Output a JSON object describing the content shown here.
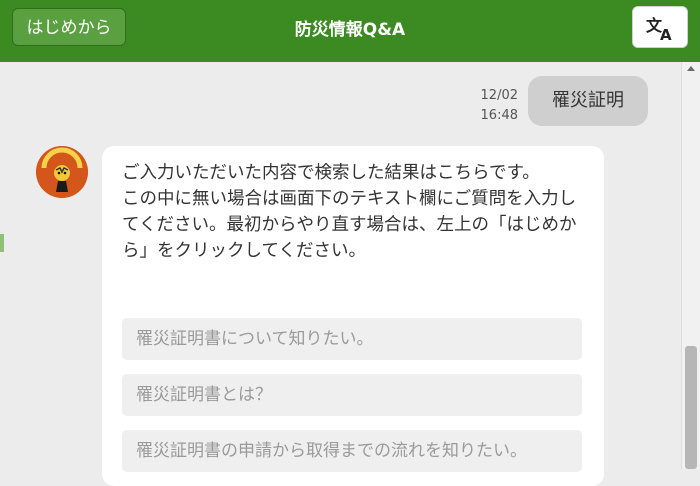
{
  "header": {
    "restart_label": "はじめから",
    "title": "防災情報Q&A",
    "translate_icon": "translate-icon"
  },
  "user_message": {
    "date": "12/02",
    "time": "16:48",
    "text": "罹災証明"
  },
  "bot_message": {
    "avatar_icon": "mascot-avatar",
    "text": "ご入力いただいた内容で検索した結果はこちらです。\nこの中に無い場合は画面下のテキスト欄にご質問を入力してください。最初からやり直す場合は、左上の「はじめから」をクリックしてください。",
    "suggestions": [
      "罹災証明書について知りたい。",
      "罹災証明書とは？",
      "罹災証明書の申請から取得までの流れを知りたい。"
    ]
  },
  "colors": {
    "header_green": "#3b8a22",
    "restart_green": "#5aa040",
    "chat_background": "#ececec",
    "user_bubble": "#cfcfcf",
    "bot_bubble": "#ffffff",
    "suggestion_background": "#efefef",
    "avatar_orange": "#d4561b"
  }
}
